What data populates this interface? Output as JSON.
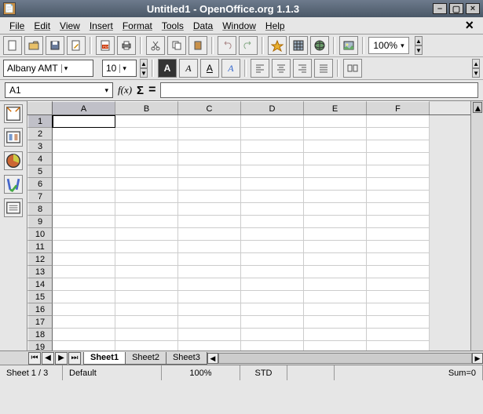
{
  "window": {
    "title": "Untitled1 - OpenOffice.org 1.1.3"
  },
  "menus": [
    "File",
    "Edit",
    "View",
    "Insert",
    "Format",
    "Tools",
    "Data",
    "Window",
    "Help"
  ],
  "toolbar1": {
    "zoom": "100%"
  },
  "toolbar2": {
    "font": "Albany AMT",
    "size": "10"
  },
  "namebox": "A1",
  "fx_label": "f(x)",
  "sigma_label": "Σ",
  "eq_label": "=",
  "columns": [
    "A",
    "B",
    "C",
    "D",
    "E",
    "F"
  ],
  "rows": [
    "1",
    "2",
    "3",
    "4",
    "5",
    "6",
    "7",
    "8",
    "9",
    "10",
    "11",
    "12",
    "13",
    "14",
    "15",
    "16",
    "17",
    "18",
    "19"
  ],
  "active_cell": "A1",
  "sheets": [
    {
      "name": "Sheet1",
      "active": true
    },
    {
      "name": "Sheet2",
      "active": false
    },
    {
      "name": "Sheet3",
      "active": false
    }
  ],
  "status": {
    "sheet": "Sheet 1 / 3",
    "style": "Default",
    "zoom": "100%",
    "mode": "STD",
    "sum": "Sum=0"
  }
}
